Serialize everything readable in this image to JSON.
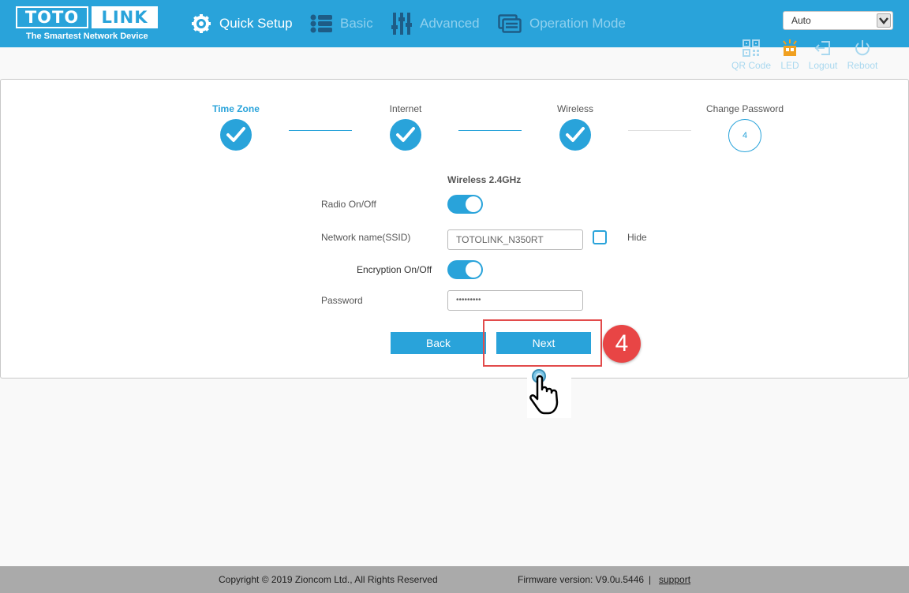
{
  "header": {
    "logo_left": "TOTO",
    "logo_right": "LINK",
    "tagline": "The Smartest Network Device",
    "nav": [
      {
        "label": "Quick Setup",
        "icon": "gear-icon"
      },
      {
        "label": "Basic",
        "icon": "list-icon"
      },
      {
        "label": "Advanced",
        "icon": "sliders-icon"
      },
      {
        "label": "Operation Mode",
        "icon": "window-icon"
      }
    ],
    "language": "Auto"
  },
  "tools": [
    {
      "label": "QR Code",
      "icon": "qr-code-icon"
    },
    {
      "label": "LED",
      "icon": "led-icon"
    },
    {
      "label": "Logout",
      "icon": "logout-icon"
    },
    {
      "label": "Reboot",
      "icon": "power-icon"
    }
  ],
  "steps": [
    {
      "label": "Time Zone",
      "state": "done"
    },
    {
      "label": "Internet",
      "state": "done"
    },
    {
      "label": "Wireless",
      "state": "done"
    },
    {
      "label": "Change Password",
      "number": "4",
      "state": "pending"
    }
  ],
  "form": {
    "section_title": "Wireless 2.4GHz",
    "radio_label": "Radio On/Off",
    "radio_on": true,
    "ssid_label": "Network name(SSID)",
    "ssid_value": "TOTOLINK_N350RT",
    "hide_label": "Hide",
    "encryption_label": "Encryption On/Off",
    "encryption_on": true,
    "password_label": "Password",
    "password_value": "•••••••••"
  },
  "buttons": {
    "back": "Back",
    "next": "Next"
  },
  "annotation": {
    "step_number": "4"
  },
  "footer": {
    "copyright": "Copyright © 2019 Zioncom Ltd., All Rights Reserved",
    "firmware": "Firmware version: V9.0u.5446",
    "separator": "|",
    "support": "support"
  },
  "colors": {
    "brand_blue": "#29a3da",
    "annotation_red": "#e84545",
    "led_orange": "#f0a020"
  }
}
